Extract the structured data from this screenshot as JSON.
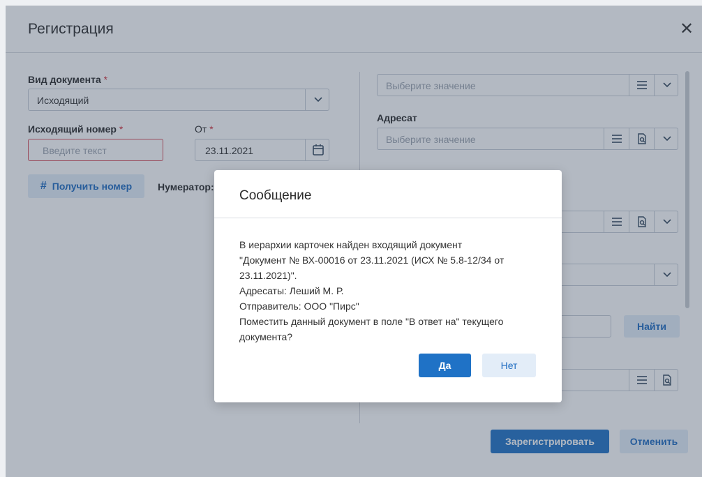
{
  "dialog": {
    "title": "Регистрация",
    "close": "✕"
  },
  "left": {
    "doc_type_label": "Вид документа",
    "doc_type_value": "Исходящий",
    "out_number_label": "Исходящий номер",
    "out_number_placeholder": "Введите текст",
    "from_label": "От",
    "from_value": "23.11.2021",
    "get_number_button": "Получить номер",
    "numerator_label": "Нумератор:",
    "required_mark": "*"
  },
  "right": {
    "field1_placeholder": "Выберите значение",
    "addressee_label": "Адресат",
    "addressee_placeholder": "Выберите значение",
    "find_button": "Найти"
  },
  "footer": {
    "register_button": "Зарегистрировать",
    "cancel_button": "Отменить"
  },
  "modal": {
    "title": "Сообщение",
    "lines": [
      "В иерархии карточек найден входящий документ",
      "\"Документ № ВХ-00016 от 23.11.2021 (ИСХ № 5.8-12/34 от",
      "23.11.2021)\".",
      "Адресаты: Леший М. Р.",
      "Отправитель: ООО \"Пирс\"",
      "Поместить данный документ в поле \"В ответ на\" текущего",
      "документа?"
    ],
    "yes_button": "Да",
    "no_button": "Нет"
  },
  "icons": {
    "dropdown": "chevron-down-icon",
    "list": "list-icon",
    "search_doc": "document-search-icon",
    "calendar": "calendar-icon",
    "hash": "hash-icon",
    "close": "close-icon"
  },
  "colors": {
    "accent": "#1f72c6",
    "error": "#d54b57",
    "light_button": "#e3edf8"
  }
}
